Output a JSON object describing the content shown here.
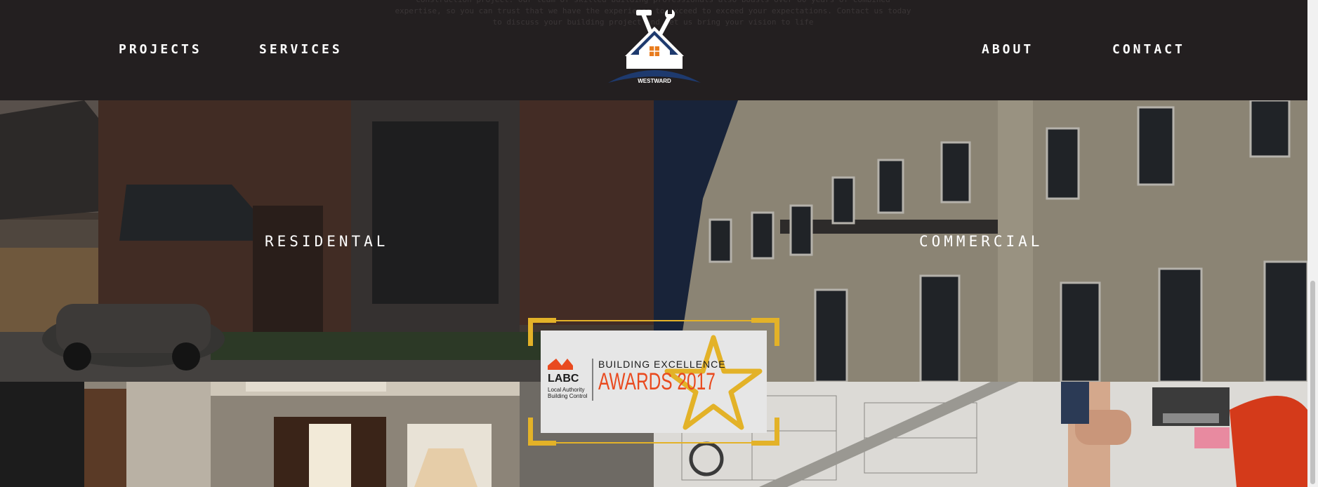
{
  "header": {
    "intro_text": "construction project. Our team of skilled building professionals also boasts over 80 years of combined expertise, so you can trust that we have the experience to exceed to exceed your expectations. Contact us today to discuss your building project and let us bring your vision to life",
    "nav_left": [
      "PROJECTS",
      "SERVICES"
    ],
    "nav_right": [
      "ABOUT",
      "CONTACT"
    ],
    "logo_text": "WESTWARD"
  },
  "tiles": {
    "residential_label": "RESIDENTAL",
    "commercial_label": "COMMERCIAL"
  },
  "award": {
    "org_name": "LABC",
    "org_subtitle": "Local Authority Building Control",
    "line1": "BUILDING EXCELLENCE",
    "line2": "AWARDS 2017"
  },
  "colors": {
    "header_bg": "#231f20",
    "logo_navy": "#1e3a6e",
    "logo_orange": "#e87c1e",
    "award_gold": "#e3b228",
    "award_red": "#e94a1f"
  },
  "icons": [
    "hammer-icon",
    "wrench-icon",
    "house-icon",
    "star-icon",
    "labc-logo-icon"
  ]
}
